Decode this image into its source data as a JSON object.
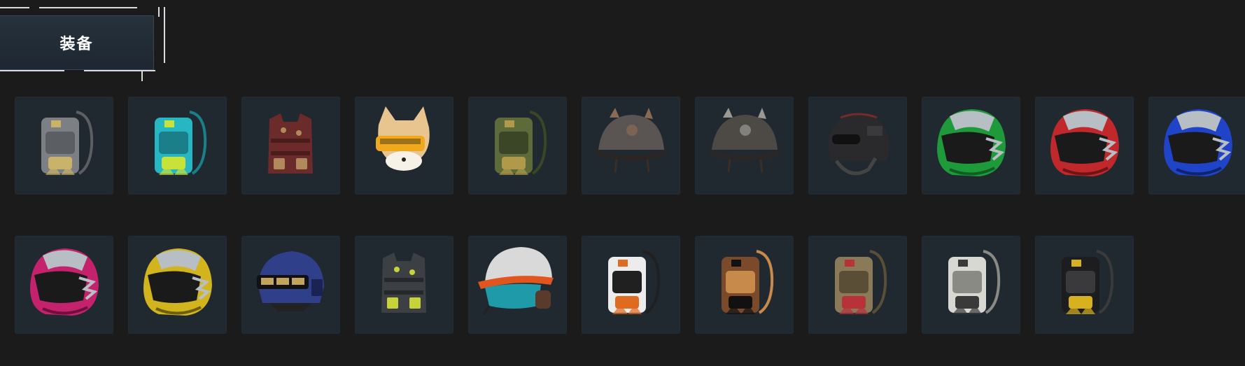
{
  "section": {
    "title": "装备"
  },
  "rows": [
    [
      {
        "name": "grey-backpack",
        "kind": "backpack",
        "c1": "#7c7f83",
        "c2": "#c9b26a",
        "c3": "#5b5e62"
      },
      {
        "name": "teal-backpack",
        "kind": "backpack",
        "c1": "#26b7c2",
        "c2": "#c8e23a",
        "c3": "#1a7f88"
      },
      {
        "name": "maroon-vest",
        "kind": "vest",
        "c1": "#6b2b2b",
        "c2": "#b08a5a",
        "c3": "#4a1c1c"
      },
      {
        "name": "cat-helmet",
        "kind": "cathelmet",
        "c1": "#e8c48f",
        "c2": "#f0a81c",
        "c3": "#f6f2e8"
      },
      {
        "name": "green-backpack",
        "kind": "backpack",
        "c1": "#5d6b3a",
        "c2": "#b09a4a",
        "c3": "#3a4626"
      },
      {
        "name": "horned-helmet",
        "kind": "helmet",
        "c1": "#5a5552",
        "c2": "#8a6a52",
        "c3": "#2a2624"
      },
      {
        "name": "winged-helmet",
        "kind": "helmet",
        "c1": "#4d4a46",
        "c2": "#9a9892",
        "c3": "#2a2826"
      },
      {
        "name": "black-ops-helmet",
        "kind": "opshelmet",
        "c1": "#2a2a2c",
        "c2": "#7a2a2a",
        "c3": "#111"
      },
      {
        "name": "green-moto-helmet",
        "kind": "moto",
        "c1": "#1f9a3a",
        "c2": "#b8bfc4",
        "c3": "#0f5f22"
      },
      {
        "name": "red-moto-helmet",
        "kind": "moto",
        "c1": "#c0282c",
        "c2": "#b8bfc4",
        "c3": "#6e1316"
      },
      {
        "name": "blue-moto-helmet",
        "kind": "moto",
        "c1": "#1f44c8",
        "c2": "#b8bfc4",
        "c3": "#0f236e"
      }
    ],
    [
      {
        "name": "pink-moto-helmet",
        "kind": "moto",
        "c1": "#c5226e",
        "c2": "#b8bfc4",
        "c3": "#6e103d"
      },
      {
        "name": "yellow-moto-helmet",
        "kind": "moto",
        "c1": "#d2b51e",
        "c2": "#b8bfc4",
        "c3": "#6e5e0f"
      },
      {
        "name": "navy-military-helmet",
        "kind": "milhelmet",
        "c1": "#2f3f8a",
        "c2": "#c2a45a",
        "c3": "#1a2352"
      },
      {
        "name": "camo-vest",
        "kind": "vest",
        "c1": "#3c4044",
        "c2": "#c7d23a",
        "c3": "#25282a"
      },
      {
        "name": "orange-visor-helmet",
        "kind": "visor",
        "c1": "#d9d9d9",
        "c2": "#e0561e",
        "c3": "#1e9aa8"
      },
      {
        "name": "white-orange-backpack",
        "kind": "backpack",
        "c1": "#ececec",
        "c2": "#e06a1e",
        "c3": "#202020"
      },
      {
        "name": "brown-black-backpack",
        "kind": "backpack",
        "c1": "#7a4a2a",
        "c2": "#111111",
        "c3": "#c88a4a"
      },
      {
        "name": "tan-canvas-backpack",
        "kind": "backpack",
        "c1": "#8a7a58",
        "c2": "#b8323a",
        "c3": "#5a4e36"
      },
      {
        "name": "snow-camo-backpack",
        "kind": "backpack",
        "c1": "#d8d8d2",
        "c2": "#3a3a3a",
        "c3": "#8a8a84"
      },
      {
        "name": "black-gold-backpack",
        "kind": "backpack",
        "c1": "#1d1d1f",
        "c2": "#d8b21e",
        "c3": "#3a3a3c"
      }
    ]
  ]
}
